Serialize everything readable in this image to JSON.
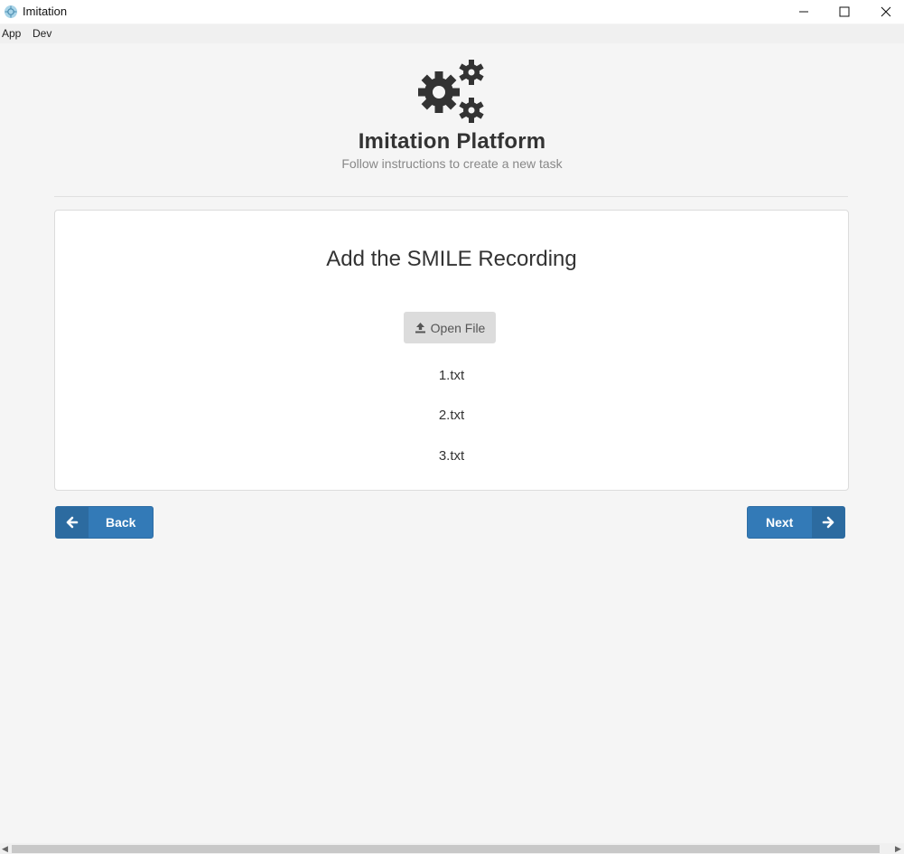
{
  "window": {
    "title": "Imitation"
  },
  "menu": {
    "app": "App",
    "dev": "Dev"
  },
  "header": {
    "title": "Imitation Platform",
    "subtitle": "Follow instructions to create a new task",
    "icon": "gears-icon"
  },
  "card": {
    "title": "Add the SMILE Recording",
    "open_file_label": "Open File",
    "files": [
      "1.txt",
      "2.txt",
      "3.txt"
    ]
  },
  "nav": {
    "back_label": "Back",
    "next_label": "Next"
  },
  "colors": {
    "primary": "#337ab7",
    "background": "#f5f5f5"
  }
}
